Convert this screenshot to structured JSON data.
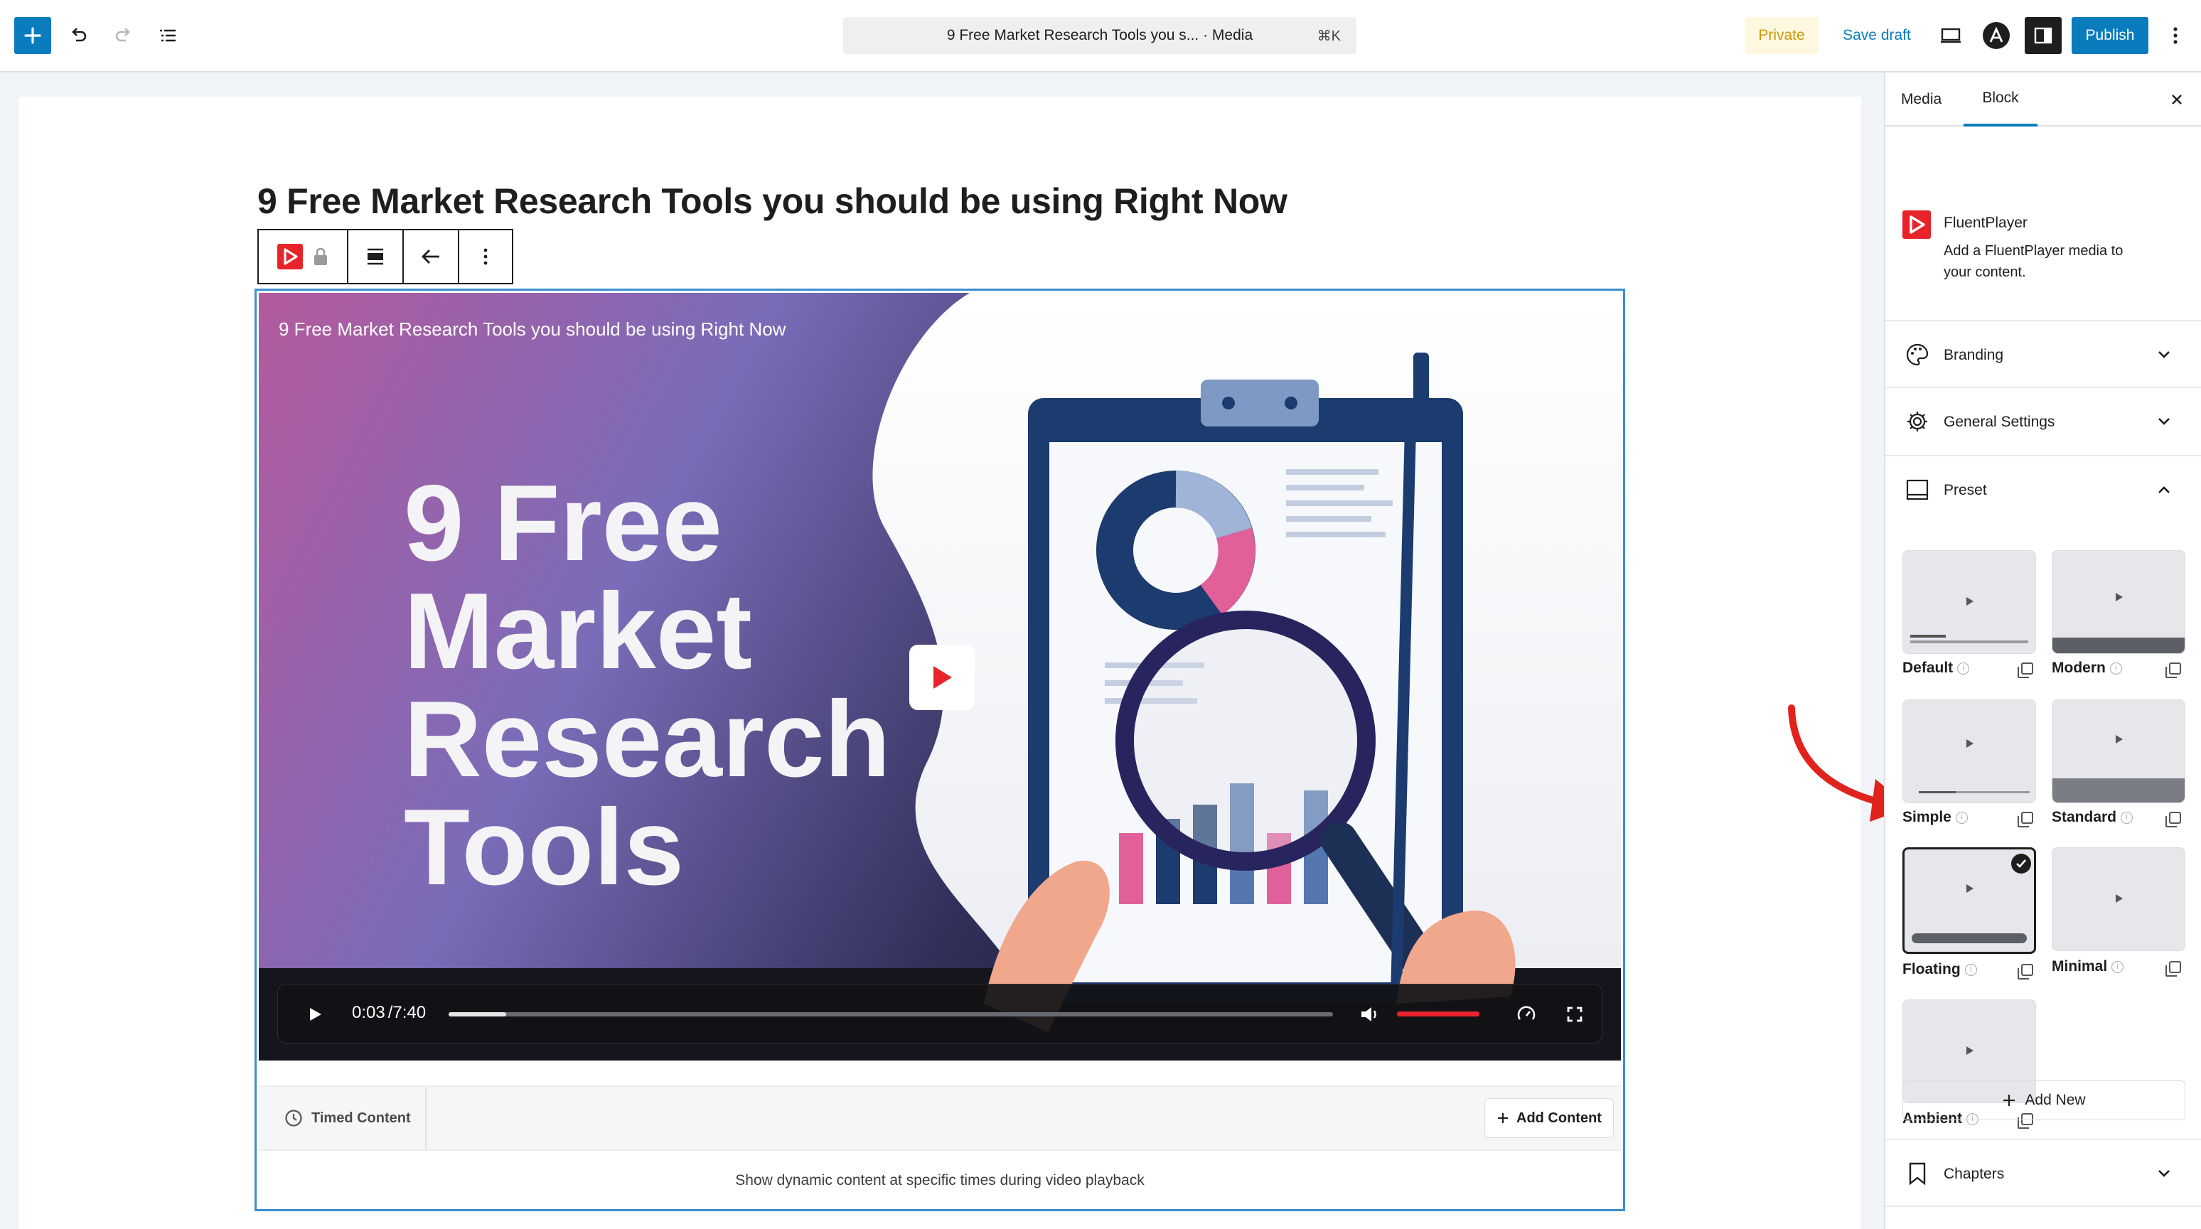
{
  "header": {
    "document_title": "9 Free Market Research Tools you s... · Media",
    "shortcut": "⌘K",
    "private_label": "Private",
    "save_draft_label": "Save draft",
    "publish_label": "Publish"
  },
  "post": {
    "title": "9 Free Market Research Tools you should be using Right Now"
  },
  "video": {
    "overlay_title": "9 Free Market Research Tools you should be using Right Now",
    "thumbnail_lines": [
      "9 Free",
      "Market",
      "Research",
      "Tools"
    ],
    "current_time": "0:03",
    "duration": "/7:40",
    "progress_fraction": 0.065,
    "volume_fraction": 1.0
  },
  "timed_content": {
    "tab_label": "Timed Content",
    "add_button_label": "Add Content",
    "description": "Show dynamic content at specific times during video playback"
  },
  "sidebar": {
    "tabs": [
      "Media",
      "Block"
    ],
    "active_tab": "Block",
    "block_name": "FluentPlayer",
    "block_description_line1": "Add a FluentPlayer media to",
    "block_description_line2": "your content.",
    "sections": {
      "branding": "Branding",
      "general_settings": "General Settings",
      "preset": "Preset",
      "chapters": "Chapters"
    },
    "presets": [
      {
        "label": "Default",
        "selected": false
      },
      {
        "label": "Modern",
        "selected": false
      },
      {
        "label": "Simple",
        "selected": false
      },
      {
        "label": "Standard",
        "selected": false
      },
      {
        "label": "Floating",
        "selected": true
      },
      {
        "label": "Minimal",
        "selected": false
      },
      {
        "label": "Ambient",
        "selected": false
      }
    ],
    "add_new_label": "Add New"
  },
  "colors": {
    "wp_blue": "#0a7bbd",
    "player_red": "#e8232a",
    "private_bg": "#fef8e1",
    "private_text": "#c9980c",
    "annotation_arrow": "#e0231c"
  }
}
